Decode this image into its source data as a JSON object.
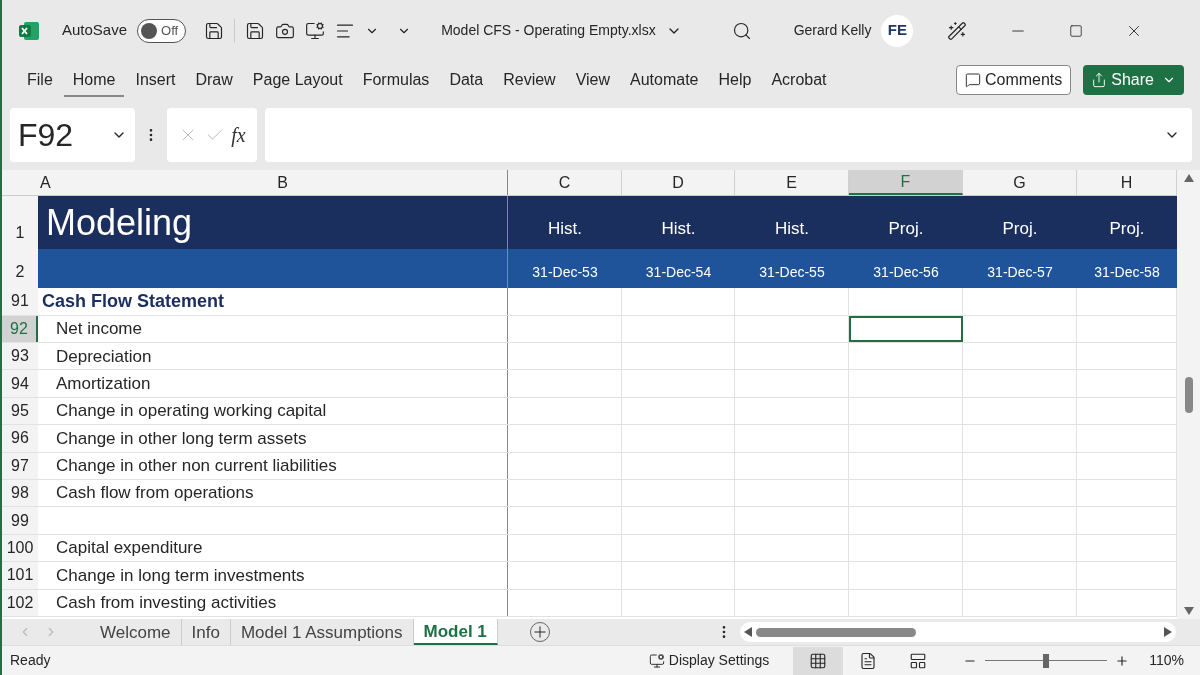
{
  "title_bar": {
    "autosave_label": "AutoSave",
    "autosave": {
      "on": false,
      "label": "Off"
    },
    "file_name": "Model CFS - Operating Empty.xlsx",
    "user_name": "Gerard Kelly",
    "user_initials": "FE"
  },
  "ribbon": {
    "tabs": [
      {
        "label": "File",
        "selected": false
      },
      {
        "label": "Home",
        "selected": true
      },
      {
        "label": "Insert",
        "selected": false
      },
      {
        "label": "Draw",
        "selected": false
      },
      {
        "label": "Page Layout",
        "selected": false
      },
      {
        "label": "Formulas",
        "selected": false
      },
      {
        "label": "Data",
        "selected": false
      },
      {
        "label": "Review",
        "selected": false
      },
      {
        "label": "View",
        "selected": false
      },
      {
        "label": "Automate",
        "selected": false
      },
      {
        "label": "Help",
        "selected": false
      },
      {
        "label": "Acrobat",
        "selected": false
      }
    ],
    "comments_label": "Comments",
    "share_label": "Share"
  },
  "formula_bar": {
    "name_box": "F92",
    "fx": "fx"
  },
  "columns": [
    {
      "label": "A",
      "selected": false
    },
    {
      "label": "B",
      "selected": false
    },
    {
      "label": "C",
      "selected": false
    },
    {
      "label": "D",
      "selected": false
    },
    {
      "label": "E",
      "selected": false
    },
    {
      "label": "F",
      "selected": true
    },
    {
      "label": "G",
      "selected": false
    },
    {
      "label": "H",
      "selected": false
    }
  ],
  "header_rows": {
    "title_row": {
      "number": "1",
      "title": "Modeling"
    },
    "date_row": {
      "number": "2"
    },
    "periods": [
      {
        "label": "Hist.",
        "date": "31-Dec-53"
      },
      {
        "label": "Hist.",
        "date": "31-Dec-54"
      },
      {
        "label": "Hist.",
        "date": "31-Dec-55"
      },
      {
        "label": "Proj.",
        "date": "31-Dec-56"
      },
      {
        "label": "Proj.",
        "date": "31-Dec-57"
      },
      {
        "label": "Proj.",
        "date": "31-Dec-58"
      }
    ]
  },
  "rows": [
    {
      "number": "91",
      "kind": "heading",
      "label": "Cash Flow Statement",
      "selected": false
    },
    {
      "number": "92",
      "kind": "item",
      "label": "Net income",
      "selected": true
    },
    {
      "number": "93",
      "kind": "item",
      "label": "Depreciation",
      "selected": false
    },
    {
      "number": "94",
      "kind": "item",
      "label": "Amortization",
      "selected": false
    },
    {
      "number": "95",
      "kind": "item",
      "label": "Change in operating working capital",
      "selected": false
    },
    {
      "number": "96",
      "kind": "item",
      "label": "Change in other long term assets",
      "selected": false
    },
    {
      "number": "97",
      "kind": "item",
      "label": "Change in other non current liabilities",
      "selected": false
    },
    {
      "number": "98",
      "kind": "item",
      "label": "Cash flow from operations",
      "selected": false
    },
    {
      "number": "99",
      "kind": "empty",
      "selected": false
    },
    {
      "number": "100",
      "kind": "item",
      "label": "Capital expenditure",
      "selected": false
    },
    {
      "number": "101",
      "kind": "item",
      "label": "Change in long term investments",
      "selected": false
    },
    {
      "number": "102",
      "kind": "item",
      "label": "Cash from investing activities",
      "selected": false
    }
  ],
  "sheet_tabs": [
    {
      "label": "Welcome",
      "selected": false
    },
    {
      "label": "Info",
      "selected": false
    },
    {
      "label": "Model 1 Assumptions",
      "selected": false
    },
    {
      "label": "Model 1",
      "selected": true
    }
  ],
  "status_bar": {
    "status": "Ready",
    "display_settings": "Display Settings",
    "views": [
      {
        "kind": "normal",
        "selected": true
      },
      {
        "kind": "page_layout",
        "selected": false
      },
      {
        "kind": "page_break",
        "selected": false
      }
    ],
    "zoom": {
      "level": 0.5,
      "label": "110%"
    }
  }
}
